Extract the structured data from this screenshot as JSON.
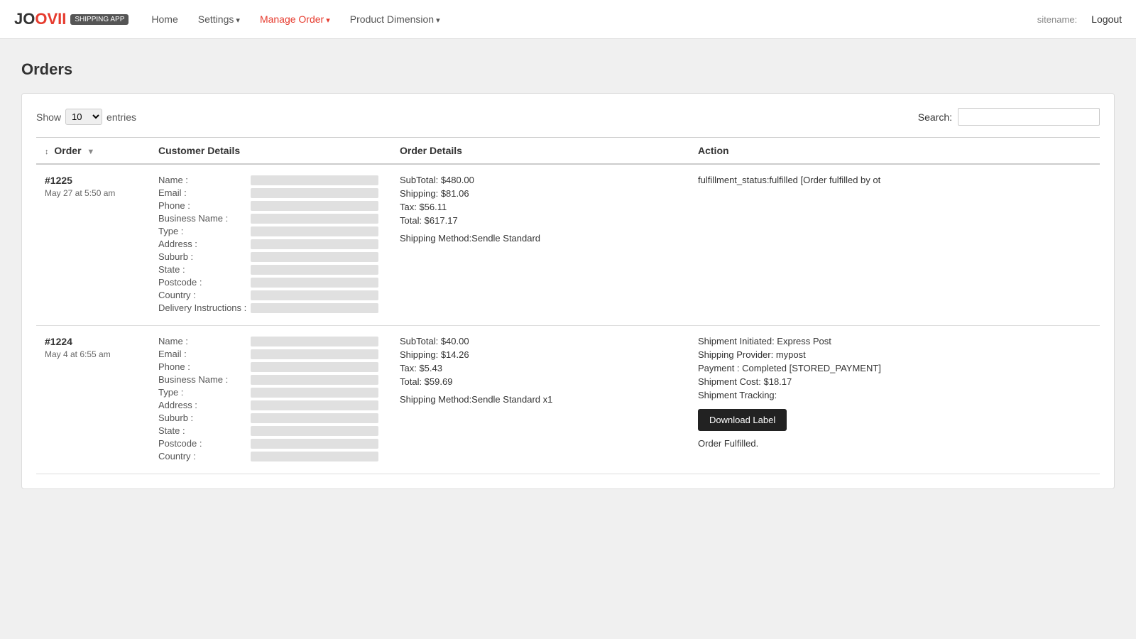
{
  "navbar": {
    "logo": "JOOVII",
    "logo_highlight": "VII",
    "badge": "SHIPPING APP",
    "links": [
      {
        "label": "Home",
        "active": false,
        "dropdown": false
      },
      {
        "label": "Settings",
        "active": false,
        "dropdown": true
      },
      {
        "label": "Manage Order",
        "active": true,
        "dropdown": true
      },
      {
        "label": "Product Dimension",
        "active": false,
        "dropdown": true
      }
    ],
    "sitename_label": "sitename:",
    "logout_label": "Logout"
  },
  "page": {
    "title": "Orders"
  },
  "table_controls": {
    "show_label": "Show",
    "entries_label": "entries",
    "show_value": "10",
    "search_label": "Search:"
  },
  "table": {
    "headers": {
      "order": "Order",
      "customer_details": "Customer Details",
      "order_details": "Order Details",
      "action": "Action"
    },
    "rows": [
      {
        "order_number": "#1225",
        "order_date": "May 27 at 5:50 am",
        "customer_fields": [
          "Name :",
          "Email :",
          "Phone :",
          "Business Name :",
          "Type :",
          "Address :",
          "Suburb :",
          "State :",
          "Postcode :",
          "Country :",
          "Delivery Instructions :"
        ],
        "order_detail_lines": [
          "SubTotal: $480.00",
          "Shipping: $81.06",
          "Tax: $56.11",
          "Total: $617.17",
          "",
          "Shipping Method:Sendle Standard"
        ],
        "action_text": "fulfillment_status:fulfilled [Order fulfilled by ot",
        "has_download": false,
        "fulfilled_text": ""
      },
      {
        "order_number": "#1224",
        "order_date": "May 4 at 6:55 am",
        "customer_fields": [
          "Name :",
          "Email :",
          "Phone :",
          "Business Name :",
          "Type :",
          "Address :",
          "Suburb :",
          "State :",
          "Postcode :",
          "Country :"
        ],
        "order_detail_lines": [
          "SubTotal: $40.00",
          "Shipping: $14.26",
          "Tax: $5.43",
          "Total: $59.69",
          "",
          "Shipping Method:Sendle Standard x1"
        ],
        "action_lines": [
          "Shipment Initiated: Express Post",
          "Shipping Provider: mypost",
          "Payment : Completed [STORED_PAYMENT]",
          "Shipment Cost: $18.17",
          "Shipment Tracking:"
        ],
        "has_download": true,
        "download_label": "Download Label",
        "fulfilled_text": "Order Fulfilled."
      }
    ]
  }
}
